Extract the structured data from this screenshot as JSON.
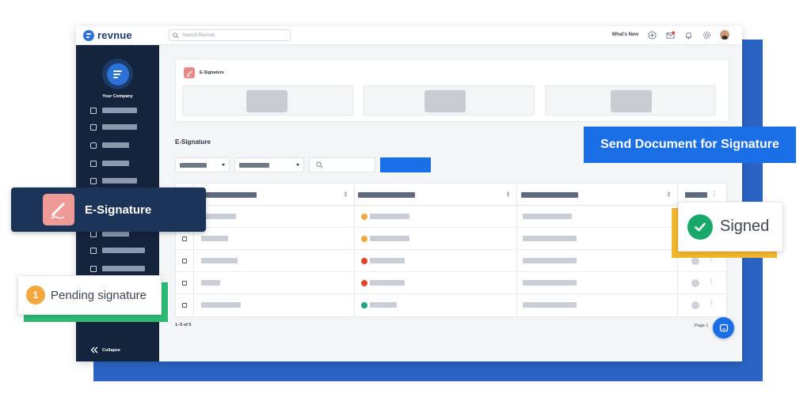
{
  "app": {
    "brand": "revnue",
    "search_placeholder": "Search Revnue",
    "whats_new": "What's New"
  },
  "sidebar": {
    "company_name": "Your Company",
    "collapse_label": "Collapse",
    "items": [
      {
        "icon": "dashboard-icon"
      },
      {
        "icon": "document-icon"
      },
      {
        "icon": "layers-icon"
      },
      {
        "icon": "cart-icon"
      },
      {
        "icon": "users-icon"
      },
      {
        "icon": "list-icon"
      },
      {
        "icon": "chart-icon"
      },
      {
        "icon": "id-card-icon"
      }
    ]
  },
  "main": {
    "card_title": "E-Signature",
    "section_title": "E-Signature",
    "pagination_summary": "1–5 of 5",
    "pagination_page": "Page 1",
    "rows": [
      {
        "status_color": "#f3a73f"
      },
      {
        "status_color": "#f3a73f"
      },
      {
        "status_color": "#e2452a"
      },
      {
        "status_color": "#e2452a"
      },
      {
        "status_color": "#1fa386"
      }
    ]
  },
  "callouts": {
    "send_document": "Send Document for Signature",
    "esignature": "E-Signature",
    "pending_number": "1",
    "pending_label": "Pending signature",
    "signed_label": "Signed"
  },
  "colors": {
    "accent": "#1a6ee6",
    "sidebar": "#15243d",
    "success": "#18a96a",
    "warning": "#f3a73f",
    "danger": "#e2452a"
  }
}
